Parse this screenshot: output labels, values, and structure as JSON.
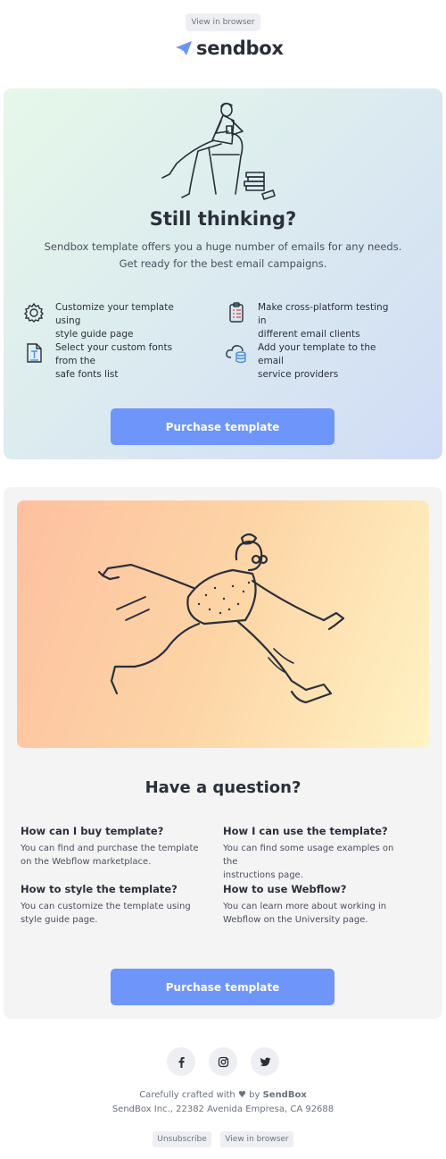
{
  "header": {
    "view_in_browser": "View in browser",
    "logo_text": "sendbox"
  },
  "hero": {
    "title": "Still thinking?",
    "subtitle_line1": "Sendbox template offers you a huge number of emails for any needs.",
    "subtitle_line2": "Get ready for the best email campaigns.",
    "features": [
      {
        "icon": "gear-icon",
        "line1": "Customize your template using",
        "line2": "style guide page"
      },
      {
        "icon": "checklist-icon",
        "line1": "Make cross-platform testing in",
        "line2": "different email clients"
      },
      {
        "icon": "font-file-icon",
        "line1": "Select your custom fonts from the",
        "line2": "safe fonts list"
      },
      {
        "icon": "cloud-database-icon",
        "line1": "Add your template to the email",
        "line2": "service providers"
      }
    ],
    "button": "Purchase template"
  },
  "questions": {
    "title": "Have a question?",
    "items": [
      {
        "q": "How can I buy template?",
        "a1": "You can find and purchase the template",
        "a2": "on the Webflow marketplace."
      },
      {
        "q": "How I can use the template?",
        "a1": "You can find some usage examples on the",
        "a2": "instructions page."
      },
      {
        "q": "How to style the template?",
        "a1": "You can customize the template using",
        "a2": "style guide page."
      },
      {
        "q": "How to use Webflow?",
        "a1": "You can learn more about working in",
        "a2": "Webflow on the University page."
      }
    ],
    "button": "Purchase template"
  },
  "footer": {
    "social": [
      "facebook-icon",
      "instagram-icon",
      "twitter-icon"
    ],
    "crafted_prefix": "Carefully crafted with",
    "crafted_by": "by",
    "brand": "SendBox",
    "address": "SendBox Inc., 22382 Avenida Empresa, CA 92688",
    "unsubscribe": "Unsubscribe",
    "view_in_browser": "View in browser"
  },
  "colors": {
    "accent": "#6e95fa",
    "text": "#2a2f3a",
    "muted": "#6b7280"
  }
}
